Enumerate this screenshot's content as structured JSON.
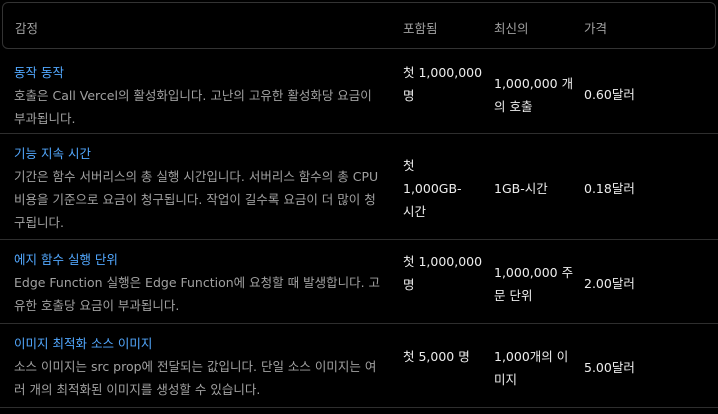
{
  "header": {
    "col0": "감정",
    "col1": "포함됨",
    "col2": "최신의",
    "col3": "가격"
  },
  "rows": [
    {
      "title": "동작 동작",
      "desc": "호출은 Call Vercel의 활성화입니다. 고난의 고유한 활성화당 요금이 부과됩니다.",
      "included": "첫 1,000,000 명",
      "unit": "1,000,000 개의 호출",
      "price": "0.60달러"
    },
    {
      "title": "기능 지속 시간",
      "desc": "기간은 함수 서버리스의 총 실행 시간입니다. 서버리스 함수의 총 CPU 비용을 기준으로 요금이 청구됩니다. 작업이 길수록 요금이 더 많이 청구됩니다.",
      "included": "첫 1,000GB-시간",
      "unit": "1GB-시간",
      "price": "0.18달러"
    },
    {
      "title": "에지 함수 실행 단위",
      "desc": "Edge Function 실행은 Edge Function에 요청할 때 발생합니다. 고유한 호출당 요금이 부과됩니다.",
      "included": "첫 1,000,000 명",
      "unit": "1,000,000 주문 단위",
      "price": "2.00달러"
    },
    {
      "title": "이미지 최적화 소스 이미지",
      "desc": "소스 이미지는 src prop에 전달되는 값입니다. 단일 소스 이미지는 여러 개의 최적화된 이미지를 생성할 수 있습니다.",
      "included": "첫 5,000 명",
      "unit": "1,000개의 이미지",
      "price": "5.00달러"
    }
  ]
}
